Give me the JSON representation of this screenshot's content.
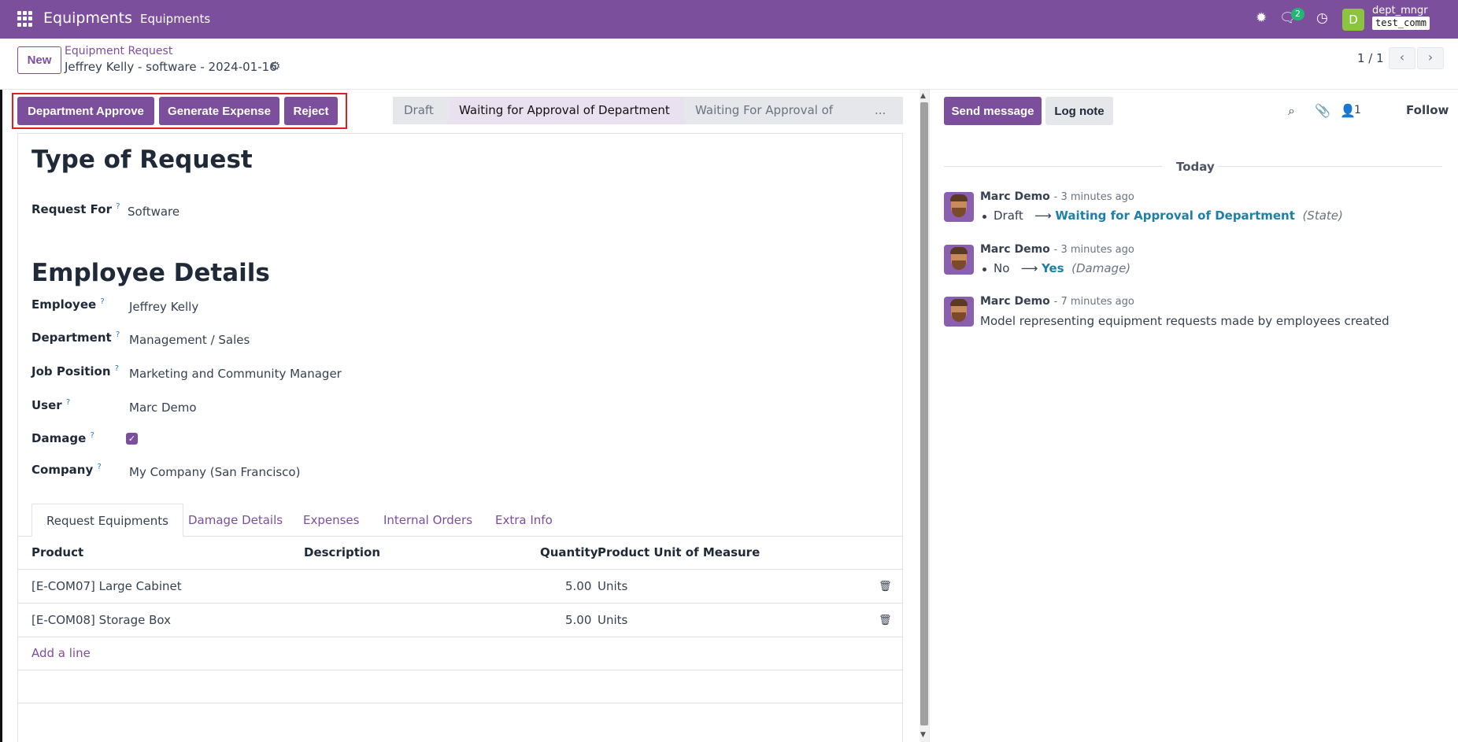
{
  "topbar": {
    "app_name": "Equipments",
    "menu": "Equipments",
    "chat_badge": "2",
    "avatar_letter": "D",
    "user": "dept_mngr",
    "db": "test_comm"
  },
  "control": {
    "new_label": "New",
    "breadcrumb": "Equipment Request",
    "record_name": "Jeffrey Kelly - software - 2024-01-16",
    "pager": "1 / 1"
  },
  "actions": {
    "approve": "Department Approve",
    "expense": "Generate Expense",
    "reject": "Reject"
  },
  "statusbar": {
    "stages": [
      "Draft",
      "Waiting for Approval of Department",
      "Waiting For Approval of HR",
      "..."
    ],
    "current": "Waiting for Approval of Department"
  },
  "form": {
    "section1": "Type of Request",
    "request_for_label": "Request For",
    "request_for": "Software",
    "section2": "Employee Details",
    "fields": [
      {
        "label": "Employee",
        "value": "Jeffrey Kelly"
      },
      {
        "label": "Department",
        "value": "Management / Sales"
      },
      {
        "label": "Job Position",
        "value": "Marketing and Community Manager"
      },
      {
        "label": "User",
        "value": "Marc Demo"
      },
      {
        "label": "Damage",
        "value": ""
      },
      {
        "label": "Company",
        "value": "My Company (San Francisco)"
      }
    ],
    "damage_checked": true,
    "help": "?"
  },
  "tabs": [
    "Request Equipments",
    "Damage Details",
    "Expenses",
    "Internal Orders",
    "Extra Info"
  ],
  "table": {
    "headers": [
      "Product",
      "Description",
      "Quantity",
      "Product Unit of Measure"
    ],
    "rows": [
      {
        "product": "[E-COM07] Large Cabinet",
        "description": "",
        "quantity": "5.00",
        "uom": "Units"
      },
      {
        "product": "[E-COM08] Storage Box",
        "description": "",
        "quantity": "5.00",
        "uom": "Units"
      }
    ],
    "add_line": "Add a line"
  },
  "chatter": {
    "send_message": "Send message",
    "log_note": "Log note",
    "followers": "1",
    "follow": "Follow",
    "today": "Today",
    "messages": [
      {
        "author": "Marc Demo",
        "ago": "- 3 minutes ago",
        "old": "Draft",
        "new": "Waiting for Approval of Department",
        "field": "(State)"
      },
      {
        "author": "Marc Demo",
        "ago": "- 3 minutes ago",
        "old": "No",
        "new": "Yes",
        "field": "(Damage)"
      },
      {
        "author": "Marc Demo",
        "ago": "- 7 minutes ago",
        "body": "Model representing equipment requests made by employees created"
      }
    ],
    "arrow": "⟶"
  },
  "colors": {
    "brand": "#7c4f9d",
    "link": "#1e7fa8",
    "badge": "#22b573",
    "highlight": "#e02020"
  }
}
